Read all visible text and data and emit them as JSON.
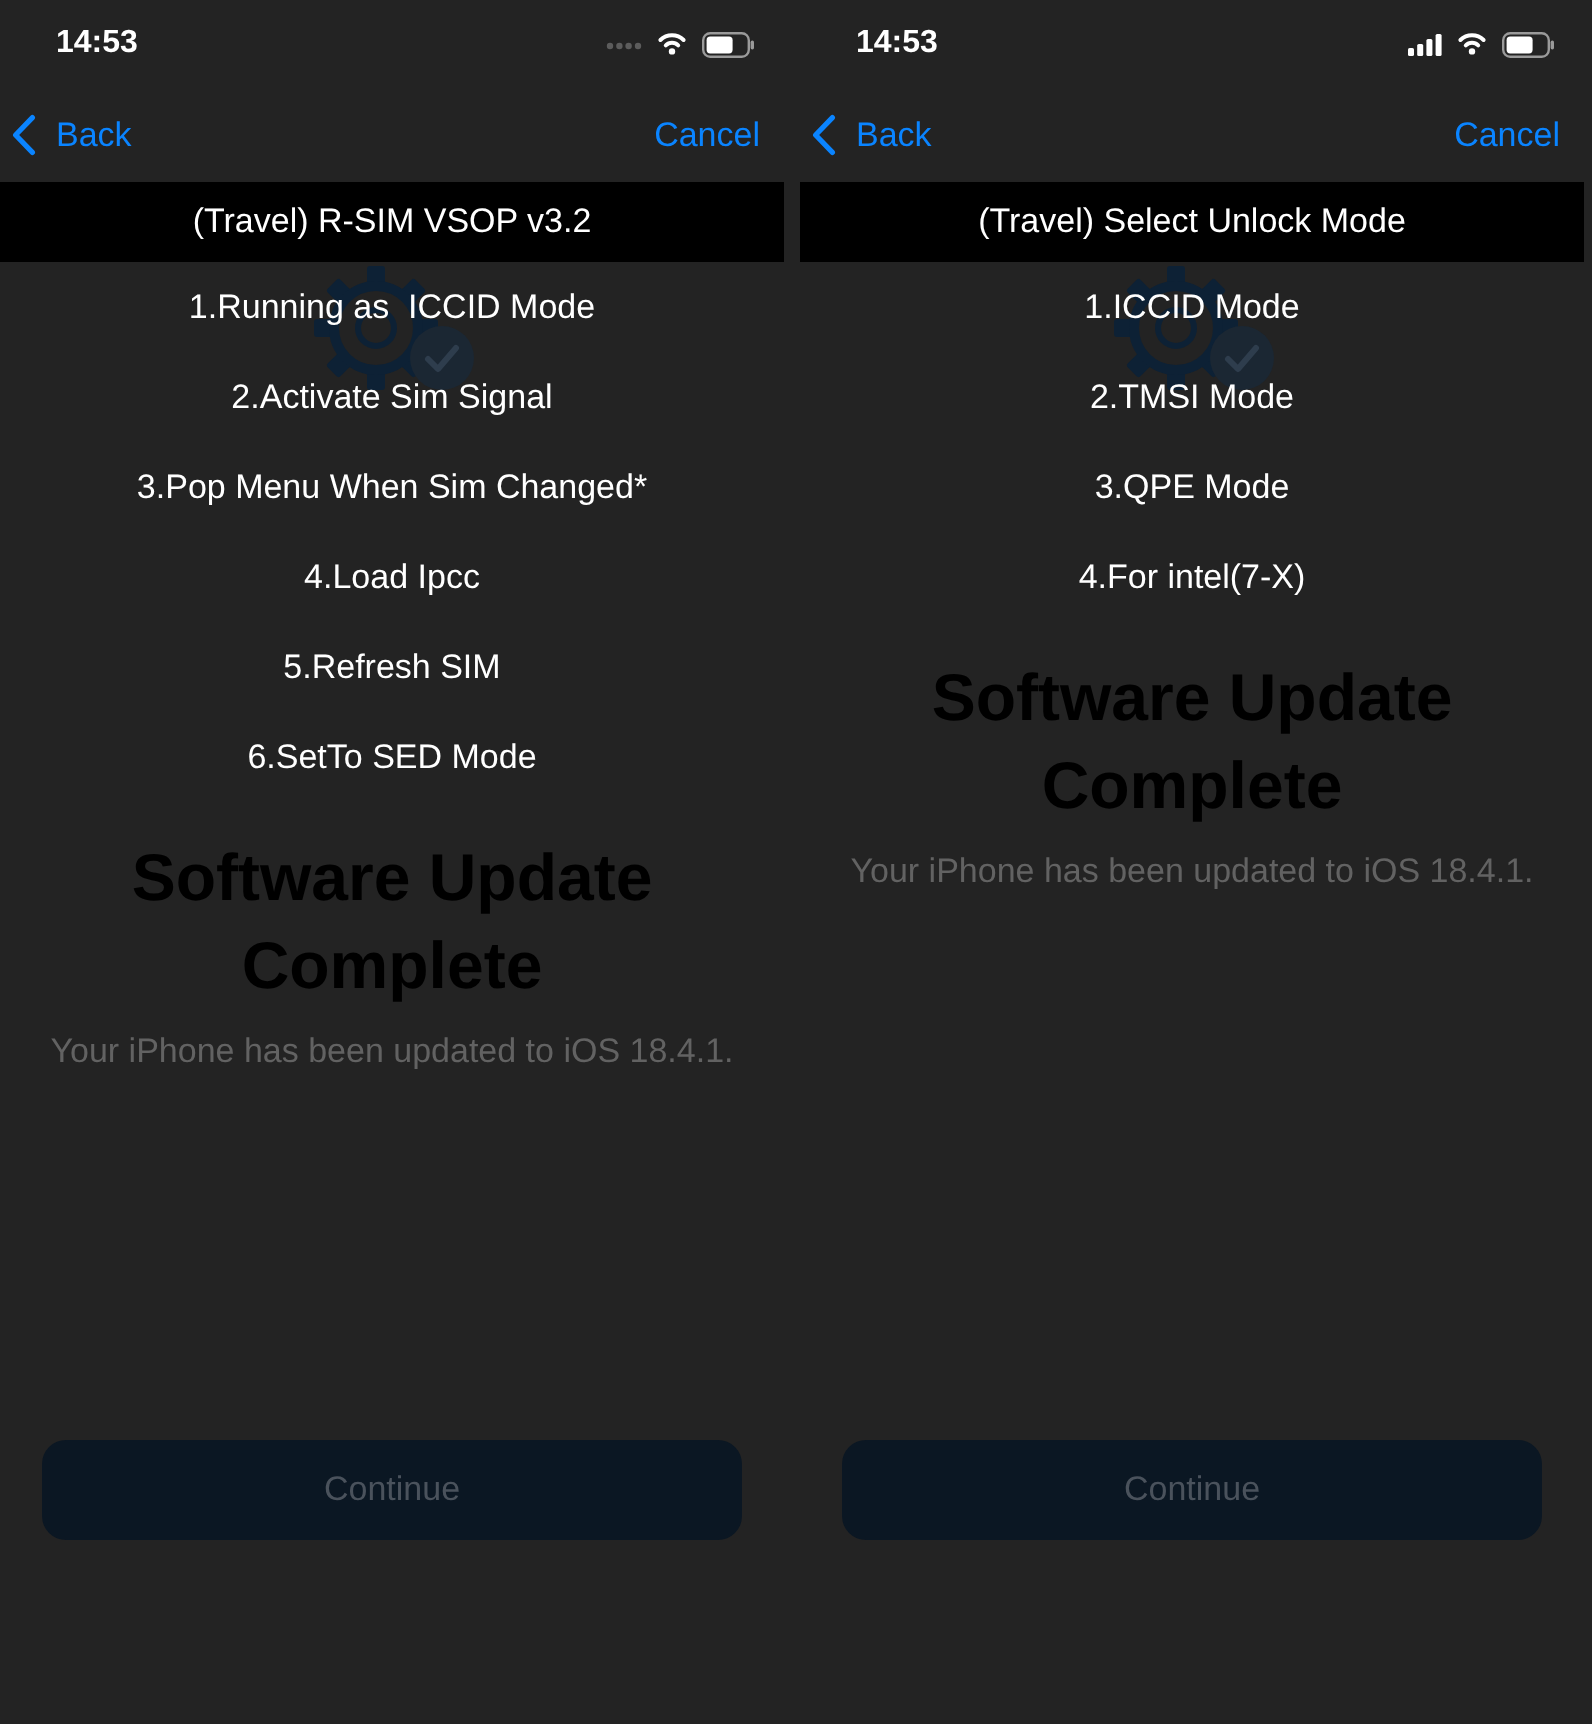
{
  "screens": [
    {
      "status_bar": {
        "time": "14:53",
        "no_service": true
      },
      "nav_bar": {
        "back": "Back",
        "cancel": "Cancel"
      },
      "menu": {
        "title": "(Travel) R-SIM VSOP v3.2",
        "items": [
          "1.Running as  ICCID Mode",
          "2.Activate Sim Signal",
          "3.Pop Menu When Sim Changed*",
          "4.Load Ipcc",
          "5.Refresh SIM",
          "6.SetTo SED Mode"
        ]
      },
      "update_screen": {
        "title": "Software Update Complete",
        "message": "Your iPhone has been updated to iOS 18.4.1.",
        "button": "Continue"
      }
    },
    {
      "status_bar": {
        "time": "14:53",
        "no_service": false
      },
      "nav_bar": {
        "back": "Back",
        "cancel": "Cancel"
      },
      "menu": {
        "title": "(Travel) Select Unlock Mode",
        "items": [
          "1.ICCID Mode",
          "2.TMSI Mode",
          "3.QPE Mode",
          "4.For intel(7-X)"
        ]
      },
      "update_screen": {
        "title": "Software Update Complete",
        "message": "Your iPhone has been updated to iOS 18.4.1.",
        "button": "Continue"
      }
    }
  ]
}
